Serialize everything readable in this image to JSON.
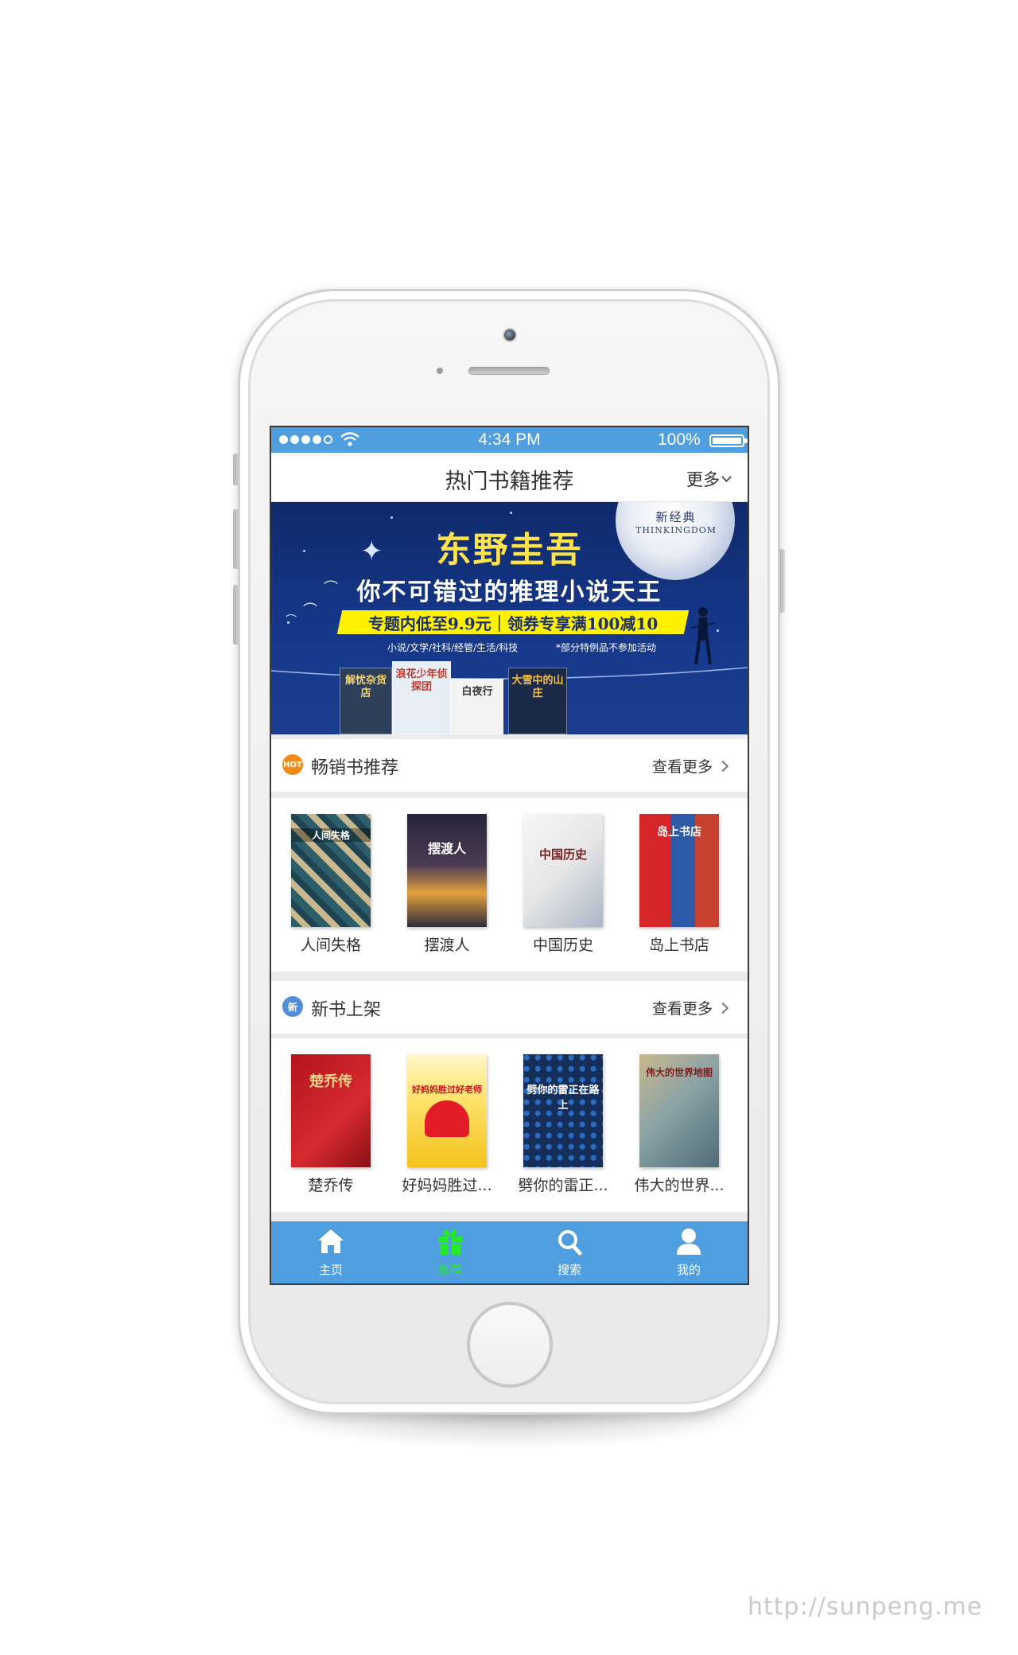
{
  "status_bar": {
    "time": "4:34 PM",
    "battery": "100%"
  },
  "header": {
    "title": "热门书籍推荐",
    "more_label": "更多"
  },
  "banner": {
    "moon_title": "新经典",
    "moon_brand": "THINKINGDOM",
    "title": "东野圭吾",
    "subtitle": "你不可错过的推理小说天王",
    "promo": "专题内低至9.9元｜领券专享满100减10",
    "categories": "小说/文学/社科/经管/生活/科技",
    "note": "*部分特例品不参加活动",
    "books": [
      "解忧杂货店",
      "浪花少年侦探团",
      "白夜行",
      "大雪中的山庄"
    ]
  },
  "bestsellers": {
    "title": "畅销书推荐",
    "badge": "HOT",
    "more_label": "查看更多",
    "books": [
      {
        "title": "人间失格",
        "cover_text": "人间失格"
      },
      {
        "title": "摆渡人",
        "cover_text": "摆渡人"
      },
      {
        "title": "中国历史",
        "cover_text": "中国历史"
      },
      {
        "title": "岛上书店",
        "cover_text": "岛上书店"
      }
    ]
  },
  "new_books": {
    "title": "新书上架",
    "badge": "新",
    "more_label": "查看更多",
    "books": [
      {
        "title": "楚乔传",
        "cover_text": "楚乔传"
      },
      {
        "title": "好妈妈胜过...",
        "cover_text": "好妈妈胜过好老师"
      },
      {
        "title": "劈你的雷正...",
        "cover_text": "劈你的雷正在路上"
      },
      {
        "title": "伟大的世界...",
        "cover_text": "伟大的世界地图"
      }
    ]
  },
  "tabbar": {
    "items": [
      {
        "label": "主页",
        "icon": "home-icon"
      },
      {
        "label": "推荐",
        "icon": "gift-icon"
      },
      {
        "label": "搜索",
        "icon": "search-icon"
      },
      {
        "label": "我的",
        "icon": "user-icon"
      }
    ],
    "active_index": 1
  },
  "colors": {
    "accent": "#4f9fe0",
    "active_tab": "#26e82a",
    "banner_bg": "#16388a"
  },
  "watermark": "http://sunpeng.me"
}
